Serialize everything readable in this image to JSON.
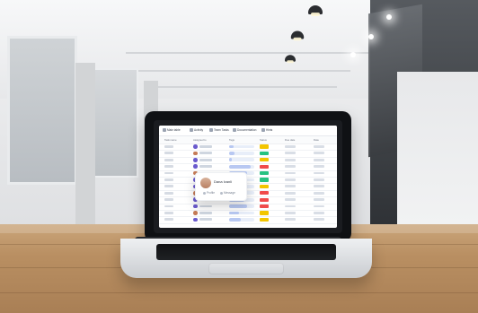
{
  "scene": {
    "colors": {
      "table": "#b98f62",
      "laptop": "#0f1114",
      "screen": "#ffffff",
      "status_green": "#26c281",
      "status_yellow": "#f3c500",
      "status_red": "#f04b4b"
    }
  },
  "screen_ui": {
    "topbar": {
      "items": [
        {
          "label": "Main table",
          "icon": "table-icon"
        },
        {
          "label": "Activity",
          "icon": "activity-icon"
        },
        {
          "label": "Team Tasks",
          "icon": "tasks-icon"
        },
        {
          "label": "Documentation",
          "icon": "doc-icon"
        },
        {
          "label": "Hints",
          "icon": "hint-icon"
        }
      ]
    },
    "header": {
      "columns": [
        "Task name",
        "Assigned to",
        "Tags",
        "Status",
        "Due date",
        "Date"
      ]
    },
    "rows": [
      {
        "status": "yellow",
        "progress": 0.18
      },
      {
        "status": "green",
        "progress": 0.22
      },
      {
        "status": "yellow",
        "progress": 0.12
      },
      {
        "status": "red",
        "progress": 0.85
      },
      {
        "status": "green",
        "progress": 0.72
      },
      {
        "status": "green",
        "progress": 0.55
      },
      {
        "status": "yellow",
        "progress": 0.25
      },
      {
        "status": "red",
        "progress": 0.33
      },
      {
        "status": "red",
        "progress": 0.62
      },
      {
        "status": "red",
        "progress": 0.7
      },
      {
        "status": "yellow",
        "progress": 0.4
      },
      {
        "status": "yellow",
        "progress": 0.46
      }
    ],
    "popup": {
      "name": "Dana Ivanli",
      "actions": [
        "Profile",
        "Message"
      ]
    }
  }
}
